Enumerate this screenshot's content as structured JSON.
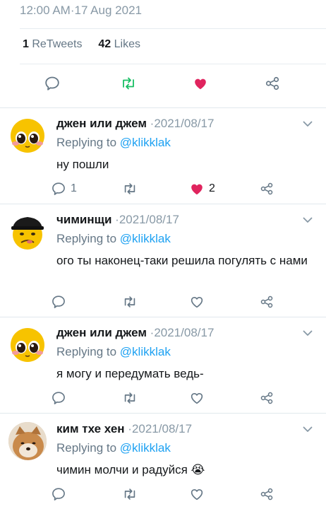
{
  "tweet": {
    "timestamp": "12:00 AM·17 Aug 2021",
    "retweet_count": "1",
    "retweet_label": "ReTweets",
    "like_count": "42",
    "like_label": "Likes"
  },
  "colors": {
    "accent": "#1da1f2",
    "retweet_green": "#17bf63",
    "like_red": "#e0245e",
    "muted": "#657786"
  },
  "replies": [
    {
      "name": "джен или джем",
      "date": "·2021/08/17",
      "replying_prefix": "Replying to",
      "handle": "@klikklak",
      "text": "ну пошли",
      "reply_count": "1",
      "like_count": "2",
      "liked": true,
      "avatar_icon": "blushing-emoji-avatar"
    },
    {
      "name": "чиминщи",
      "date": "·2021/08/17",
      "replying_prefix": "Replying to",
      "handle": "@klikklak",
      "text": "ого ты наконец-таки решила погулять с нами",
      "reply_count": "",
      "like_count": "",
      "liked": false,
      "avatar_icon": "cap-emoji-avatar"
    },
    {
      "name": "джен или джем",
      "date": "·2021/08/17",
      "replying_prefix": "Replying to",
      "handle": "@klikklak",
      "text": "я могу и передумать ведь-",
      "reply_count": "",
      "like_count": "",
      "liked": false,
      "avatar_icon": "blushing-emoji-avatar"
    },
    {
      "name": "ким тхе хен",
      "date": "·2021/08/17",
      "replying_prefix": "Replying to",
      "handle": "@klikklak",
      "text": "чимин молчи и радуйся 😭",
      "reply_count": "",
      "like_count": "",
      "liked": false,
      "avatar_icon": "dog-photo-avatar"
    }
  ]
}
